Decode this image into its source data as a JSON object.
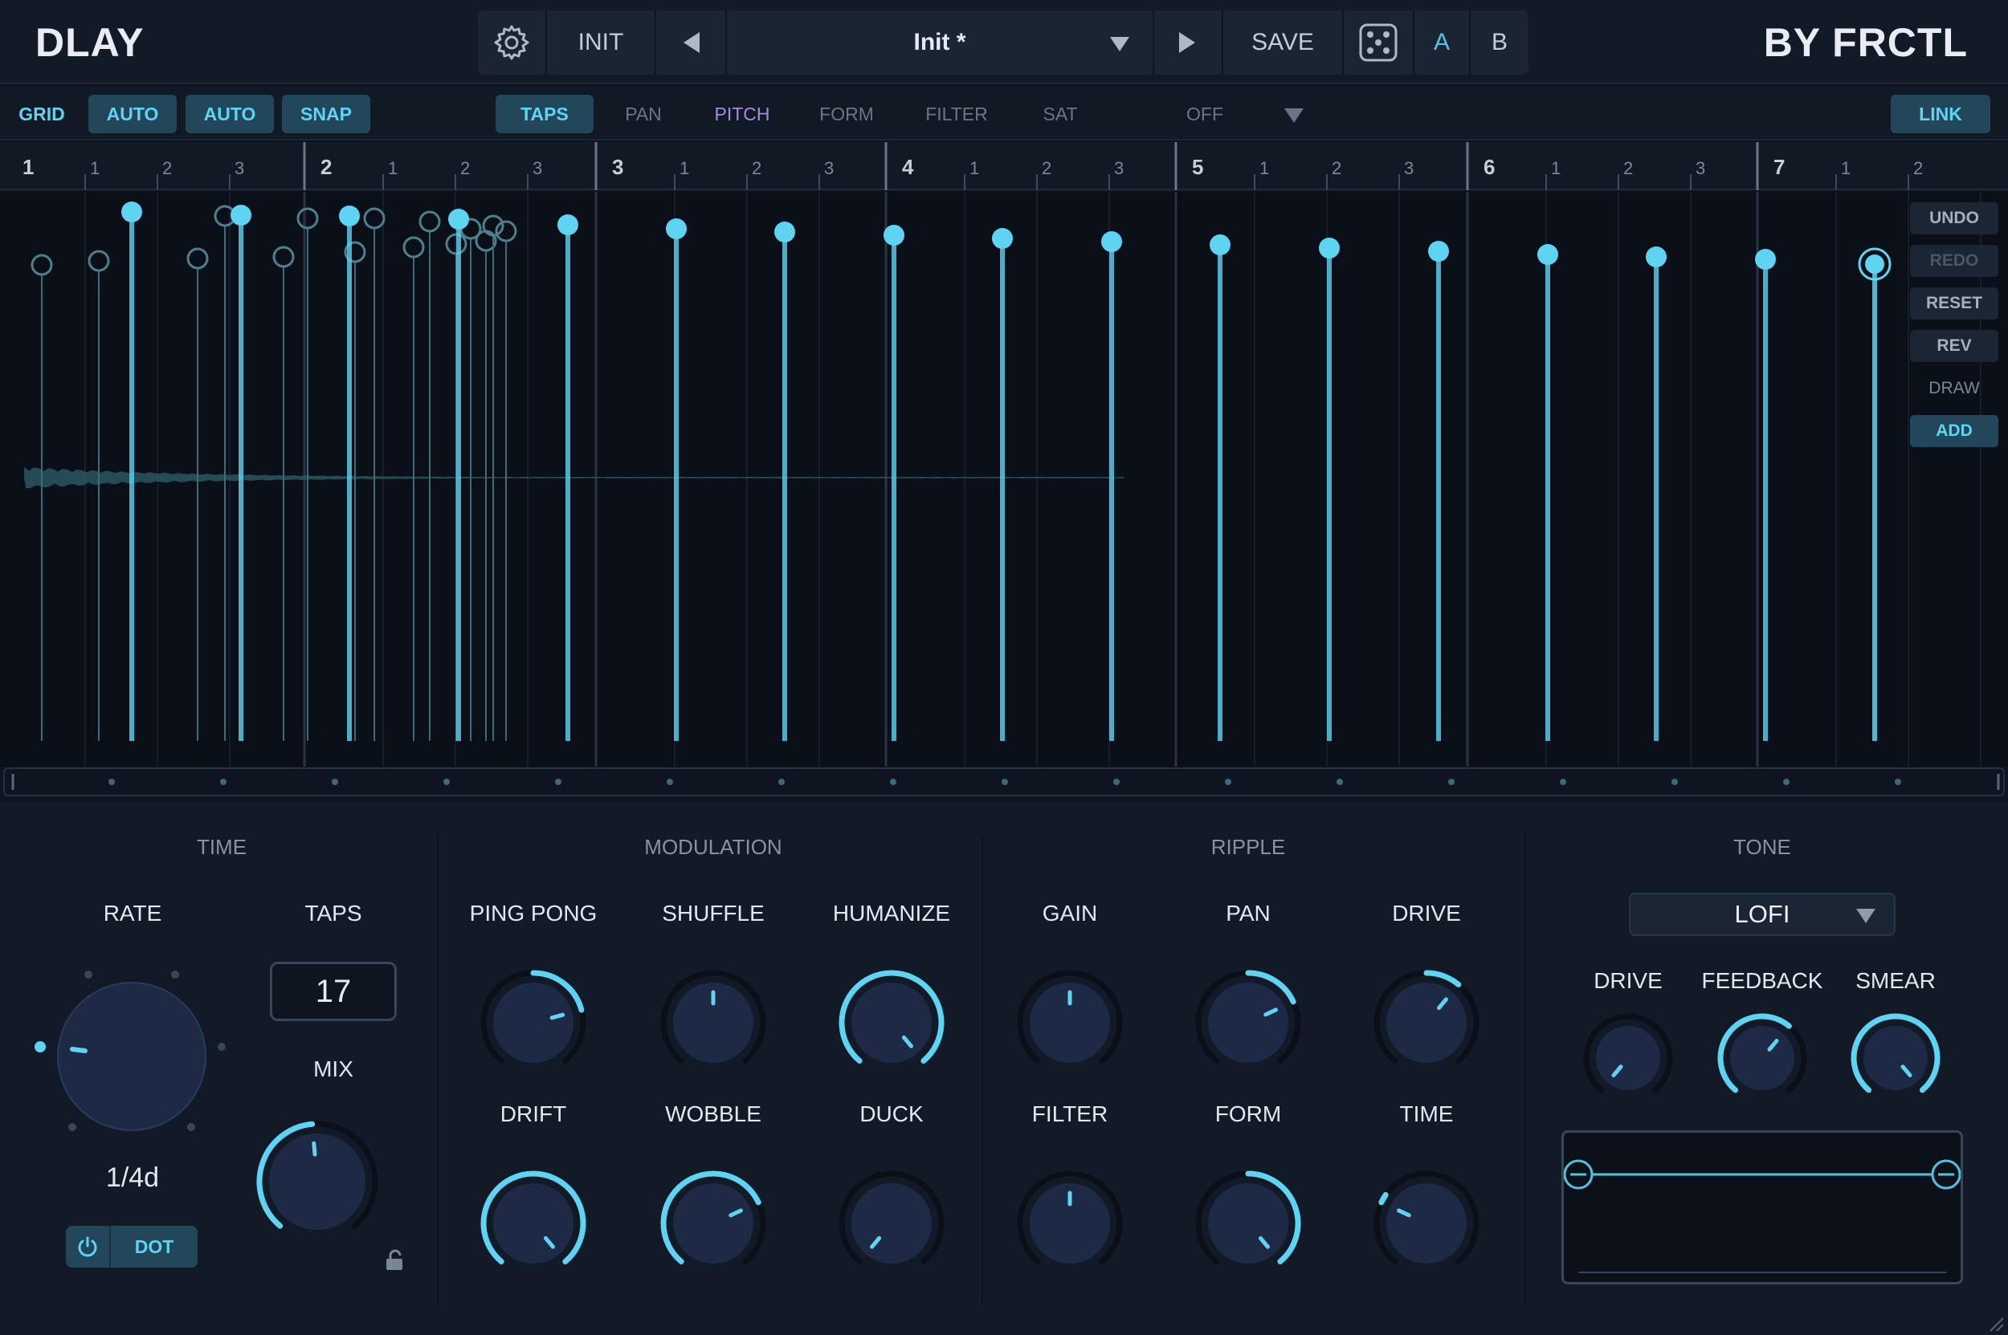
{
  "header": {
    "app_name": "DLAY",
    "brand": "BY FRCTL",
    "init_label": "INIT",
    "preset_name": "Init *",
    "save_label": "SAVE",
    "a_label": "A",
    "b_label": "B",
    "icons": [
      "gear-icon",
      "prev-arrow-icon",
      "dropdown-arrow-icon",
      "next-arrow-icon",
      "dice-icon"
    ]
  },
  "toolbar": {
    "grid_label": "GRID",
    "auto1_label": "AUTO",
    "auto2_label": "AUTO",
    "snap_label": "SNAP",
    "tabs": [
      "TAPS",
      "PAN",
      "PITCH",
      "FORM",
      "FILTER",
      "SAT"
    ],
    "active_tab": "TAPS",
    "off_label": "OFF",
    "link_label": "LINK"
  },
  "ruler": {
    "bars": [
      "1",
      "2",
      "3",
      "4",
      "5",
      "6",
      "7"
    ],
    "beats": [
      "1",
      "2",
      "3"
    ]
  },
  "side_buttons": {
    "undo": "UNDO",
    "redo": "REDO",
    "reset": "RESET",
    "rev": "REV",
    "draw": "DRAW",
    "add": "ADD"
  },
  "time": {
    "title": "TIME",
    "rate_label": "RATE",
    "rate_value": "1/4d",
    "taps_label": "TAPS",
    "taps_value": "17",
    "mix_label": "MIX",
    "dot_label": "DOT"
  },
  "modulation": {
    "title": "MODULATION",
    "knobs": [
      "PING PONG",
      "SHUFFLE",
      "HUMANIZE",
      "DRIFT",
      "WOBBLE",
      "DUCK"
    ]
  },
  "ripple": {
    "title": "RIPPLE",
    "knobs": [
      "GAIN",
      "PAN",
      "DRIVE",
      "FILTER",
      "FORM",
      "TIME"
    ]
  },
  "tone": {
    "title": "TONE",
    "mode": "LOFI",
    "knobs": [
      "DRIVE",
      "FEEDBACK",
      "SMEAR"
    ]
  },
  "colors": {
    "accent": "#5fd4f2",
    "pitch": "#a28de0",
    "background": "#121a27"
  }
}
